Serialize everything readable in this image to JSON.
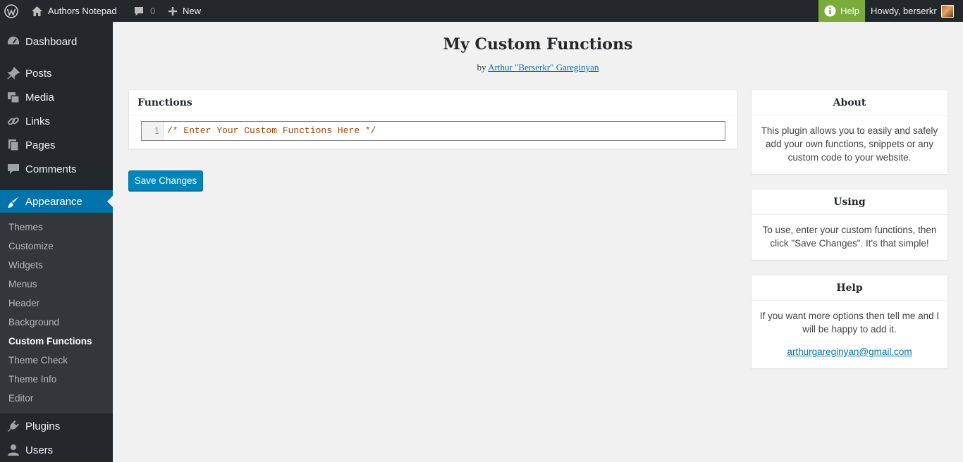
{
  "admin_bar": {
    "site_name": "Authors Notepad",
    "comments_count": "0",
    "new_label": "New",
    "help_label": "Help",
    "howdy": "Howdy, berserkr"
  },
  "sidebar": {
    "top_items": [
      {
        "label": "Dashboard",
        "icon": "dashboard-icon"
      },
      {
        "label": "Posts",
        "icon": "pin-icon"
      },
      {
        "label": "Media",
        "icon": "media-icon"
      },
      {
        "label": "Links",
        "icon": "link-icon"
      },
      {
        "label": "Pages",
        "icon": "pages-icon"
      },
      {
        "label": "Comments",
        "icon": "comment-icon"
      },
      {
        "label": "Appearance",
        "icon": "brush-icon"
      }
    ],
    "submenu": [
      "Themes",
      "Customize",
      "Widgets",
      "Menus",
      "Header",
      "Background",
      "Custom Functions",
      "Theme Check",
      "Theme Info",
      "Editor"
    ],
    "bottom_items": [
      {
        "label": "Plugins",
        "icon": "plug-icon"
      },
      {
        "label": "Users",
        "icon": "user-icon"
      }
    ],
    "current_submenu": "Custom Functions"
  },
  "main": {
    "title": "My Custom Functions",
    "byline_prefix": "by",
    "author_link": "Arthur \"Berserkr\" Gareginyan",
    "functions_box": {
      "title": "Functions",
      "line_number": "1",
      "code": "/* Enter Your Custom Functions Here */"
    },
    "save_button": "Save Changes"
  },
  "side_boxes": {
    "about": {
      "title": "About",
      "text": "This plugin allows you to easily and safely add your own functions, snippets or any custom code to your website."
    },
    "using": {
      "title": "Using",
      "text": "To use, enter your custom functions, then click \"Save Changes\". It's that simple!"
    },
    "help": {
      "title": "Help",
      "text": "If you want more options then tell me and I will be happy to add it.",
      "email": "arthurgareginyan@gmail.com"
    }
  },
  "colors": {
    "admin_bg": "#23282d",
    "accent": "#0073aa",
    "help_green": "#7bac3b",
    "code_color": "#a0430a"
  }
}
